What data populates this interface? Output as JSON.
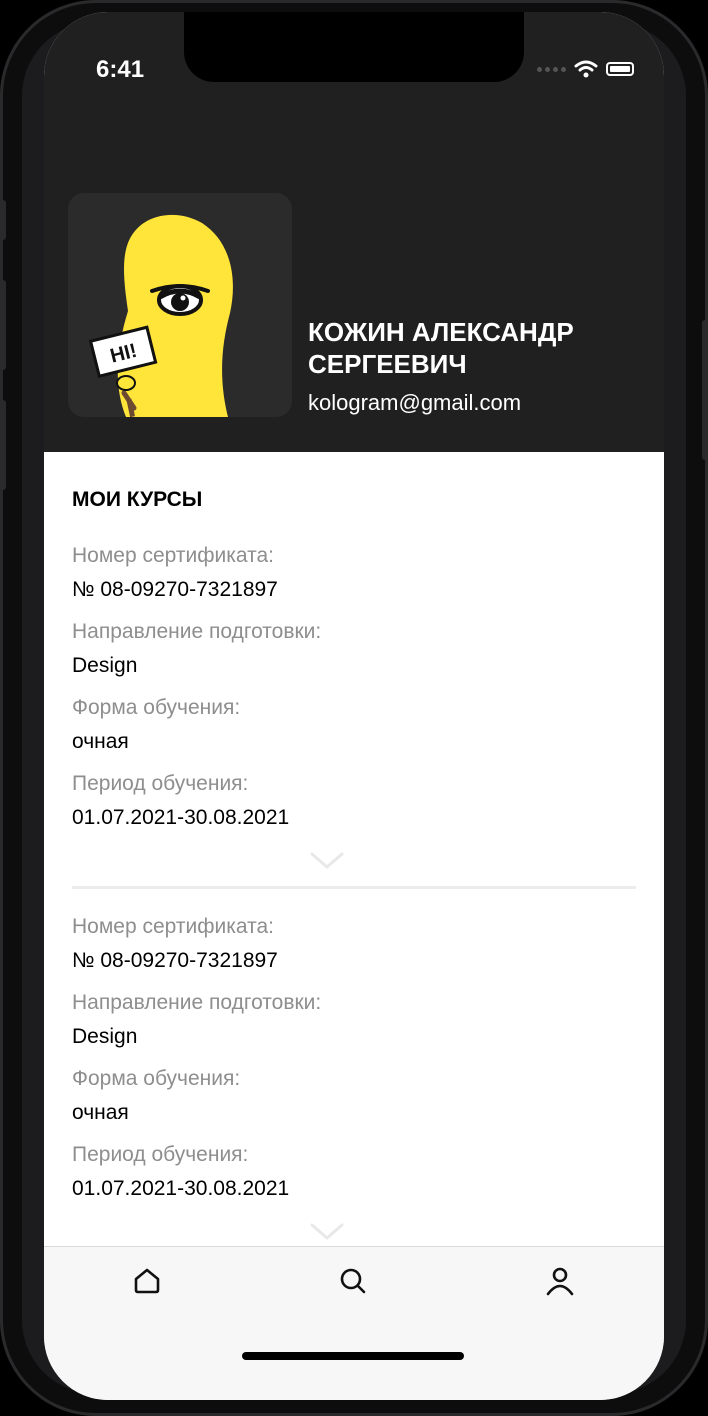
{
  "status_bar": {
    "time": "6:41"
  },
  "profile": {
    "avatar_sign_text": "HI!",
    "name": "КОЖИН АЛЕКСАНДР СЕРГЕЕВИЧ",
    "email": "kologram@gmail.com"
  },
  "courses_section": {
    "title": "МОИ КУРСЫ",
    "courses": [
      {
        "certificate_label": "Номер сертификата:",
        "certificate_value": "№ 08-09270-7321897",
        "direction_label": "Направление подготовки:",
        "direction_value": "Design",
        "form_label": "Форма обучения:",
        "form_value": "очная",
        "period_label": "Период обучения:",
        "period_value": "01.07.2021-30.08.2021"
      },
      {
        "certificate_label": "Номер сертификата:",
        "certificate_value": "№ 08-09270-7321897",
        "direction_label": "Направление подготовки:",
        "direction_value": "Design",
        "form_label": "Форма обучения:",
        "form_value": "очная",
        "period_label": "Период обучения:",
        "period_value": "01.07.2021-30.08.2021"
      }
    ]
  },
  "tab_bar": {
    "items": [
      {
        "icon": "home-icon"
      },
      {
        "icon": "search-icon"
      },
      {
        "icon": "profile-icon"
      }
    ]
  },
  "colors": {
    "header_bg": "#202020",
    "mascot_yellow": "#FFE43A",
    "label_gray": "#8E8E8E",
    "text": "#000000"
  }
}
